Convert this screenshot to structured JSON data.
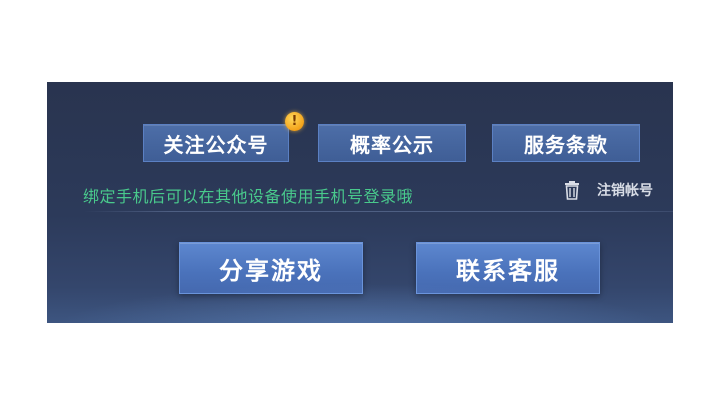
{
  "buttons": {
    "follow": "关注公众号",
    "probability": "概率公示",
    "terms": "服务条款",
    "share": "分享游戏",
    "contact": "联系客服"
  },
  "notice_badge": "!",
  "hint_text": "绑定手机后可以在其他设备使用手机号登录哦",
  "cancel_account": "注销帐号",
  "icons": {
    "notice": "exclamation-badge-icon",
    "cancel": "trash-icon"
  },
  "colors": {
    "hint": "#49c98c",
    "badge": "#f3a21a",
    "button": "#4a72bb"
  }
}
